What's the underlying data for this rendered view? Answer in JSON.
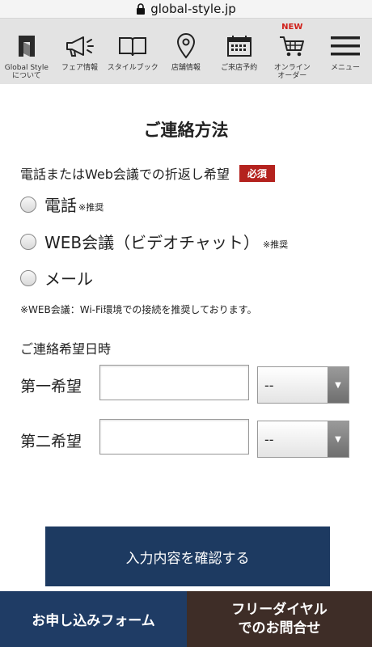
{
  "browser": {
    "url": "global-style.jp"
  },
  "nav": {
    "items": [
      {
        "label": "Global Style\nについて",
        "icon": "logo-icon"
      },
      {
        "label": "フェア情報",
        "icon": "megaphone-icon"
      },
      {
        "label": "スタイルブック",
        "icon": "book-icon"
      },
      {
        "label": "店舗情報",
        "icon": "map-pin-icon"
      },
      {
        "label": "ご来店予約",
        "icon": "calendar-icon"
      },
      {
        "label": "オンライン\nオーダー",
        "icon": "cart-icon",
        "badge": "NEW"
      },
      {
        "label": "メニュー",
        "icon": "hamburger-icon"
      }
    ]
  },
  "form": {
    "title": "ご連絡方法",
    "callback_question": "電話またはWeb会議での折返し希望",
    "required_badge": "必須",
    "options": [
      {
        "label": "電話",
        "sub": "※推奨"
      },
      {
        "label": "WEB会議（ビデオチャット）",
        "sub": "※推奨"
      },
      {
        "label": "メール",
        "sub": ""
      }
    ],
    "note": "※WEB会議：Wi-Fi環境での接続を推奨しております。",
    "datetime_label": "ご連絡希望日時",
    "preferences": [
      {
        "label": "第一希望",
        "date_value": "",
        "time_value": "--"
      },
      {
        "label": "第二希望",
        "date_value": "",
        "time_value": "--"
      }
    ],
    "confirm_button": "入力内容を確認する"
  },
  "footer": {
    "left_label": "お申し込みフォーム",
    "right_line1": "フリーダイヤル",
    "right_line2": "でのお問合せ"
  },
  "colors": {
    "nav_bg": "#e3e3e3",
    "required_red": "#b4221e",
    "confirm_navy": "#1d3a61",
    "footer_navy": "#1f3c65",
    "footer_brown": "#3e2d27"
  }
}
